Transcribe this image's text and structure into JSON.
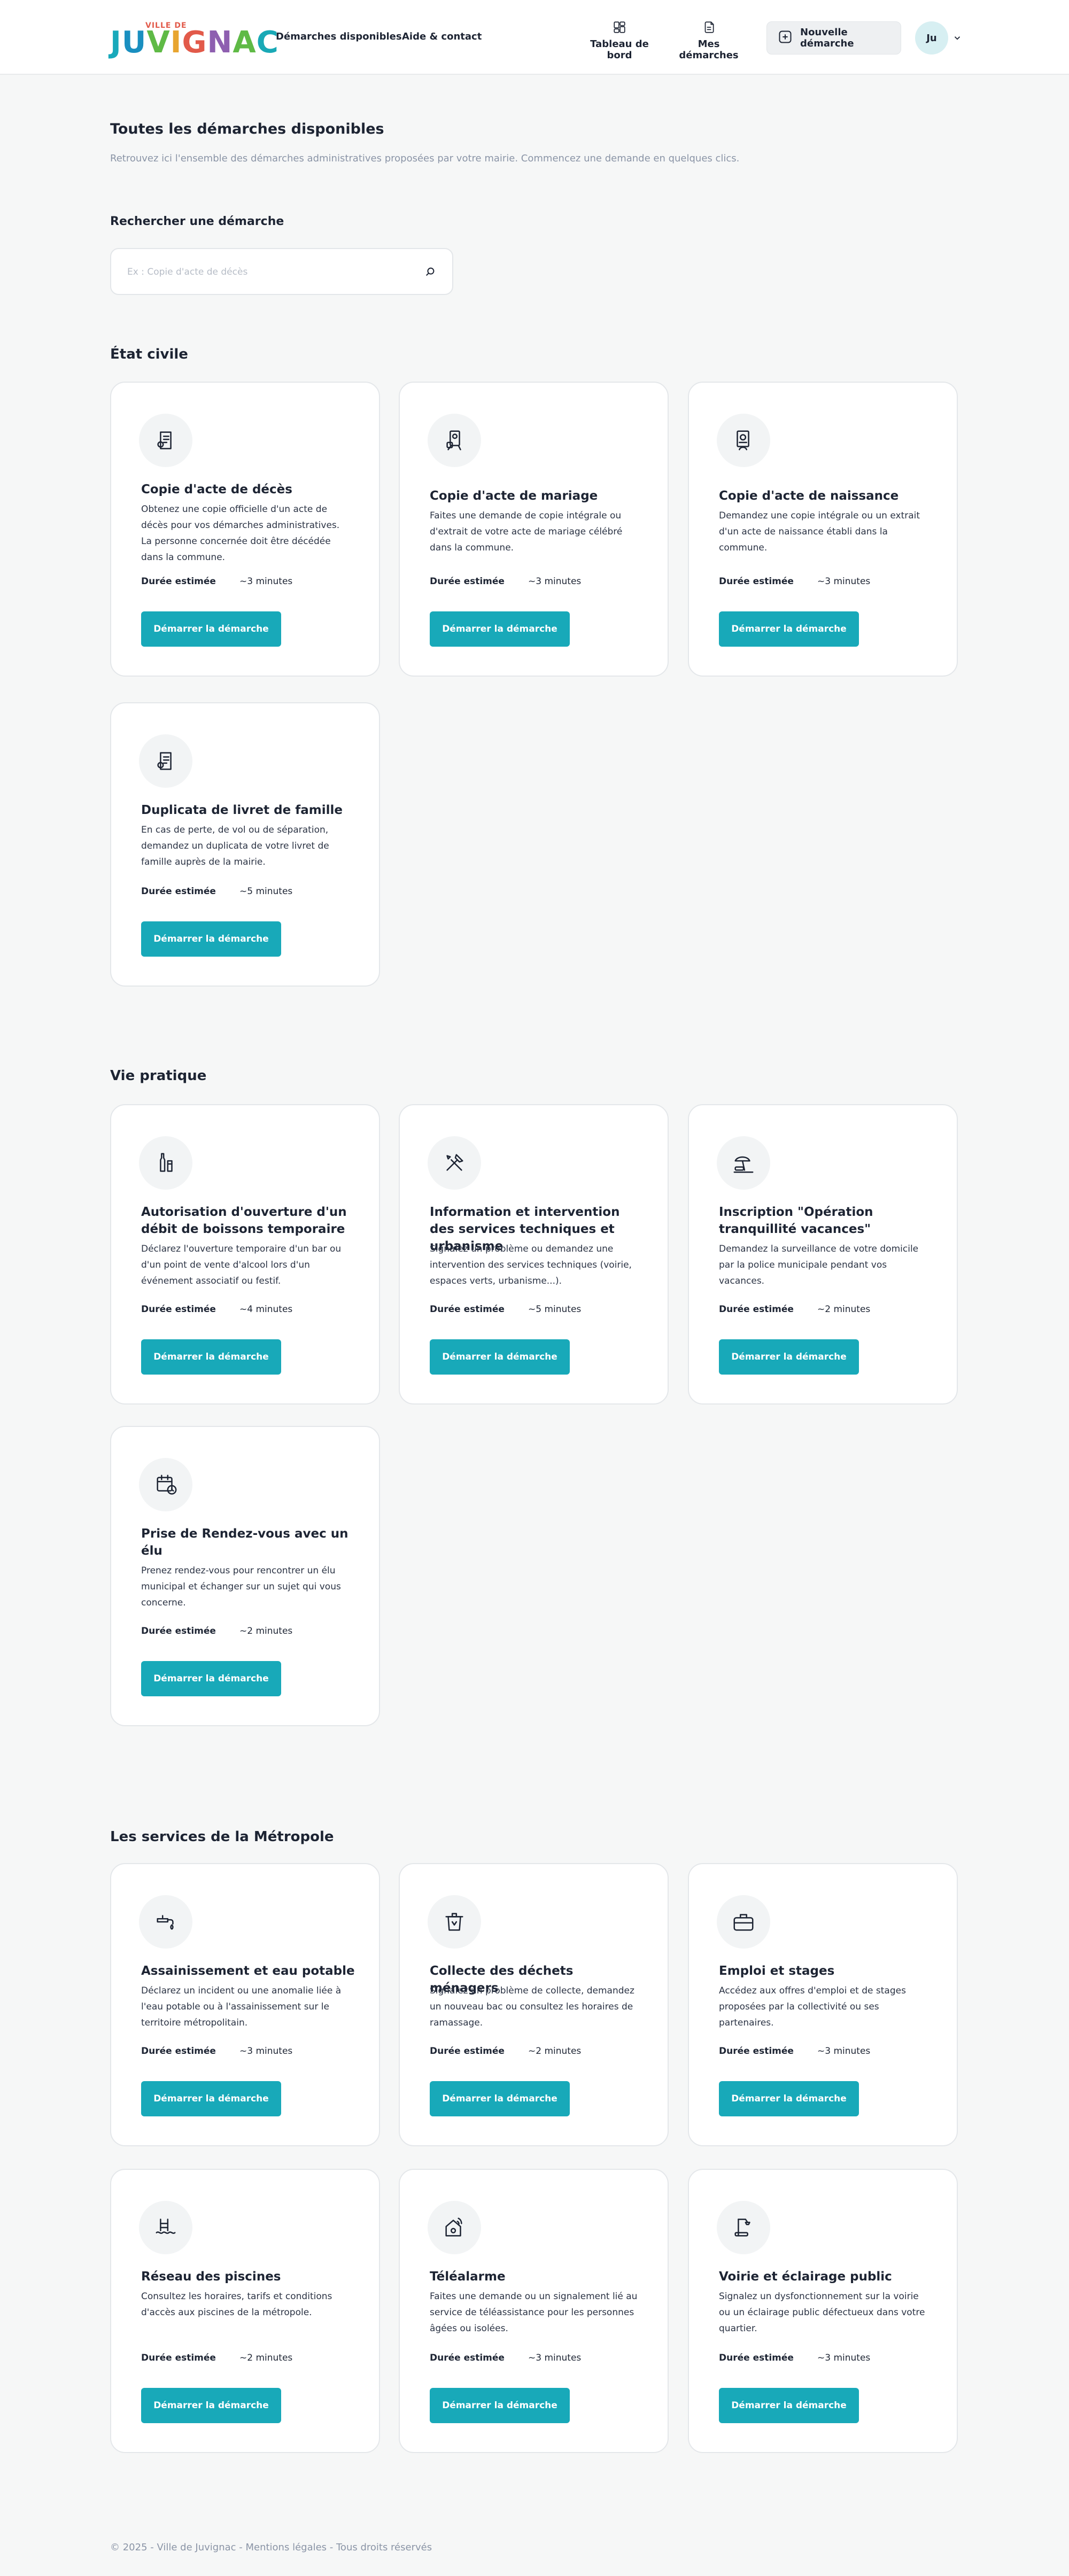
{
  "header": {
    "logo_top": "VILLE DE",
    "logo_letters": [
      "J",
      "U",
      "V",
      "I",
      "G",
      "N",
      "A",
      "C"
    ],
    "nav_demarches": "Démarches disponibles",
    "nav_aide": "Aide & contact",
    "nav_dashboard": "Tableau de bord",
    "nav_mes_demarches": "Mes démarches",
    "new_button": "Nouvelle démarche",
    "avatar": "Ju",
    "icons": {
      "dashboard": "layout-grid-icon",
      "mes_demarches": "documents-icon",
      "new": "plus-square-icon",
      "menu": "chevron-down-icon"
    }
  },
  "intro": {
    "title": "Toutes les démarches disponibles",
    "subtitle": "Retrouvez ici l'ensemble des démarches administratives proposées par votre mairie. Commencez une demande en quelques clics."
  },
  "search": {
    "label": "Rechercher une démarche",
    "placeholder": "Ex : Copie d'acte de décès",
    "value": "",
    "icon": "search-icon"
  },
  "labels": {
    "duration": "Durée estimée",
    "start": "Démarrer la démarche"
  },
  "sections": [
    {
      "title": "État civile",
      "cards": [
        {
          "icon": "death-certificate-icon",
          "title": "Copie d'acte de décès",
          "desc": "Obtenez une copie officielle d'un acte de décès pour vos démarches administratives. La personne concernée doit être décédée dans la commune.",
          "duration": "~3 minutes"
        },
        {
          "icon": "marriage-certificate-icon",
          "title": "Copie d'acte de mariage",
          "desc": "Faites une demande de copie intégrale ou d'extrait de votre acte de mariage célébré dans la commune.",
          "duration": "~3 minutes"
        },
        {
          "icon": "birth-certificate-icon",
          "title": "Copie d'acte de naissance",
          "desc": "Demandez une copie intégrale ou un extrait d'un acte de naissance établi dans la commune.",
          "duration": "~3 minutes"
        },
        {
          "icon": "family-booklet-icon",
          "title": "Duplicata de livret de famille",
          "desc": "En cas de perte, de vol ou de séparation, demandez un duplicata de votre livret de famille auprès de la mairie.",
          "duration": "~5 minutes"
        }
      ]
    },
    {
      "title": "Vie pratique",
      "cards": [
        {
          "icon": "drinks-icon",
          "title": "Autorisation d'ouverture d'un débit de boissons temporaire",
          "desc": "Déclarez l'ouverture temporaire d'un bar ou d'un point de vente d'alcool lors d'un événement associatif ou festif.",
          "duration": "~4 minutes"
        },
        {
          "icon": "tools-icon",
          "title": "Information et intervention des services techniques et urbanisme",
          "desc": "Signalez un problème ou demandez une intervention des services techniques (voirie, espaces verts, urbanisme...).",
          "duration": "~5 minutes"
        },
        {
          "icon": "beach-icon",
          "title": "Inscription \"Opération tranquillité vacances\"",
          "desc": "Demandez la surveillance de votre domicile par la police municipale pendant vos vacances.",
          "duration": "~2 minutes"
        },
        {
          "icon": "calendar-icon",
          "title": "Prise de Rendez-vous avec un élu",
          "desc": "Prenez rendez-vous pour rencontrer un élu municipal et échanger sur un sujet qui vous concerne.",
          "duration": "~2 minutes"
        }
      ]
    },
    {
      "title": "Les services de la Métropole",
      "cards": [
        {
          "icon": "water-tap-icon",
          "title": "Assainissement et eau potable",
          "desc": "Déclarez un incident ou une anomalie liée à l'eau potable ou à l'assainissement sur le territoire métropolitain.",
          "duration": "~3 minutes"
        },
        {
          "icon": "trash-bin-icon",
          "title": "Collecte des déchets ménagers",
          "desc": "Signalez un problème de collecte, demandez un nouveau bac ou consultez les horaires de ramassage.",
          "duration": "~2 minutes"
        },
        {
          "icon": "briefcase-icon",
          "title": "Emploi et stages",
          "desc": "Accédez aux offres d'emploi et de stages proposées par la collectivité ou ses partenaires.",
          "duration": "~3 minutes"
        },
        {
          "icon": "pool-icon",
          "title": "Réseau des piscines",
          "desc": "Consultez les horaires, tarifs et conditions d'accès aux piscines de la métropole.",
          "duration": "~2 minutes"
        },
        {
          "icon": "home-alarm-icon",
          "title": "Téléalarme",
          "desc": "Faites une demande ou un signalement lié au service de téléassistance pour les personnes âgées ou isolées.",
          "duration": "~3 minutes"
        },
        {
          "icon": "street-light-icon",
          "title": "Voirie et éclairage public",
          "desc": "Signalez un dysfonctionnement sur la voirie ou un éclairage public défectueux dans votre quartier.",
          "duration": "~3 minutes"
        }
      ]
    }
  ],
  "footer": "© 2025 - Ville de Juvignac - Mentions légales - Tous droits réservés",
  "colors": {
    "accent": "#18a9b9",
    "background": "#f6f7f7",
    "text": "#1d2433",
    "muted": "#8a94a6"
  }
}
